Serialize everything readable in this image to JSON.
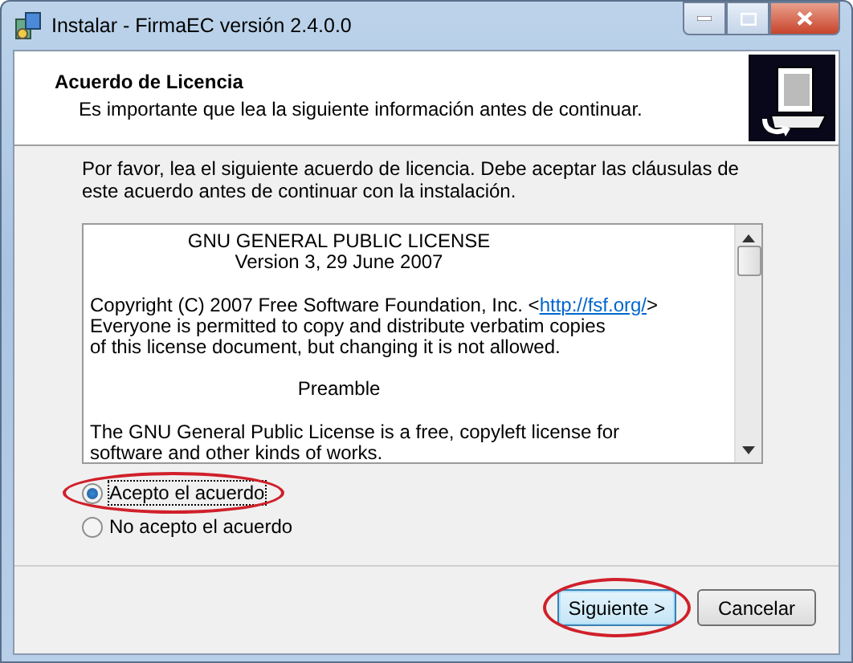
{
  "window": {
    "title": "Instalar - FirmaEC versión 2.4.0.0"
  },
  "header": {
    "title": "Acuerdo de Licencia",
    "subtitle": "Es importante que lea la siguiente información antes de continuar."
  },
  "intro": "Por favor, lea el siguiente acuerdo de licencia. Debe aceptar las cláusulas de este acuerdo antes de continuar con la instalación.",
  "license": {
    "paragraphs": [
      {
        "kind": "centered",
        "lines": [
          {
            "text": "GNU GENERAL PUBLIC LICENSE"
          },
          {
            "text": "Version 3, 29 June 2007"
          }
        ]
      },
      {
        "kind": "text",
        "lines": [
          {
            "text": "Copyright (C) 2007 Free Software Foundation, Inc. <",
            "link": "http://fsf.org/",
            "after": ">"
          },
          {
            "text": "Everyone is permitted to copy and distribute verbatim copies"
          },
          {
            "text": "of this license document, but changing it is not allowed."
          }
        ]
      },
      {
        "kind": "centered",
        "lines": [
          {
            "text": "Preamble"
          }
        ]
      },
      {
        "kind": "text",
        "lines": [
          {
            "text": "The GNU General Public License is a free, copyleft license for"
          },
          {
            "text": "software and other kinds of works."
          }
        ]
      }
    ]
  },
  "options": [
    {
      "label": "Acepto el acuerdo",
      "selected": true,
      "highlighted": true
    },
    {
      "label": "No acepto el acuerdo",
      "selected": false,
      "highlighted": false
    }
  ],
  "buttons": [
    {
      "label": "Siguiente >",
      "default": true,
      "highlighted": true
    },
    {
      "label": "Cancelar",
      "default": false,
      "highlighted": false
    }
  ]
}
